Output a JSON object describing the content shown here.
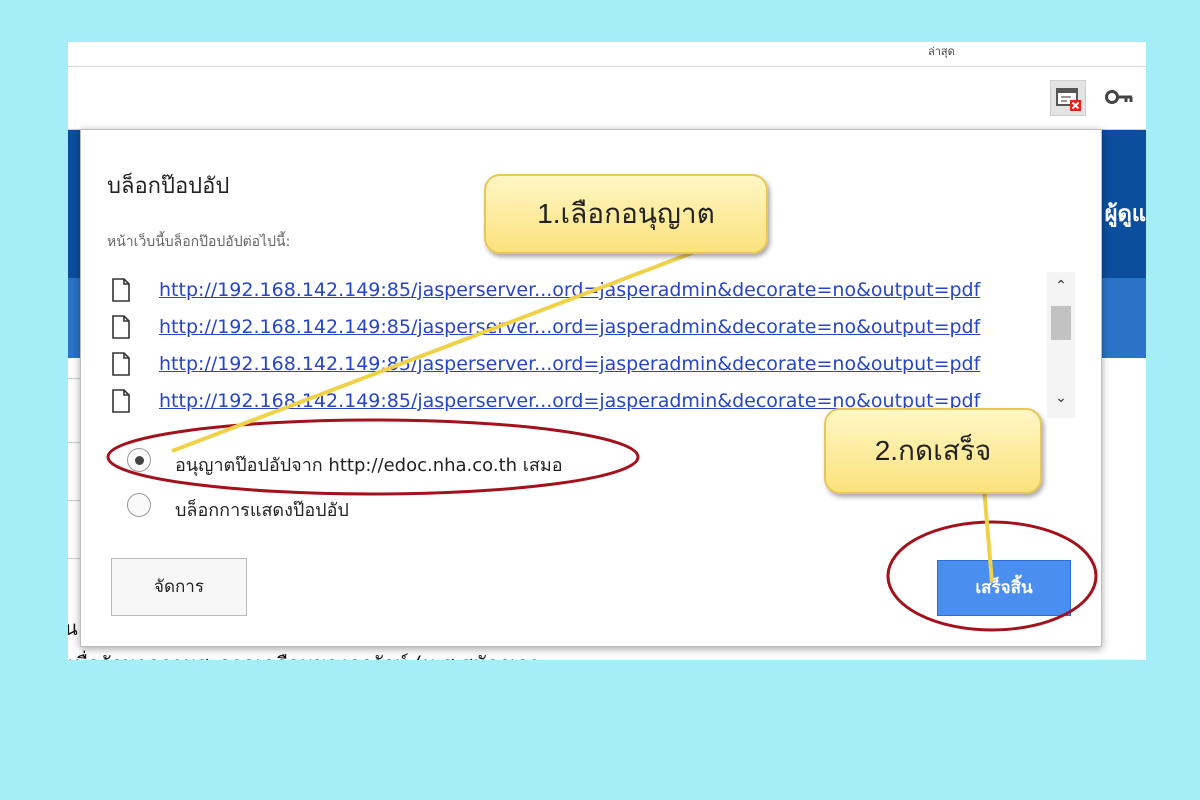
{
  "colors": {
    "background": "#a6eef7",
    "link": "#2645c8",
    "primary_button": "#4a8ef0",
    "highlight_ellipse": "#a3121c",
    "callout_fill": "#fbe27c",
    "callout_line": "#f0d24a",
    "page_header_blue": "#0b4e9e"
  },
  "browser": {
    "tab_scrap": "ล่าสุด",
    "popup_blocked_icon": "popup-blocked-icon",
    "key_icon": "key-icon"
  },
  "page_behind": {
    "header_text": "ผู้ดูแ",
    "line1": "น",
    "line2": "เพื่อรักษาความสะอาดเคลือบของครูรักษ์ (ม.ส.สมัครเอา"
  },
  "dialog": {
    "title": "บล็อกป๊อปอัป",
    "subtitle": "หน้าเว็บนี้บล็อกป๊อปอัปต่อไปนี้:",
    "urls": [
      "http://192.168.142.149:85/jasperserver...ord=jasperadmin&decorate=no&output=pdf",
      "http://192.168.142.149:85/jasperserver...ord=jasperadmin&decorate=no&output=pdf",
      "http://192.168.142.149:85/jasperserver...ord=jasperadmin&decorate=no&output=pdf",
      "http://192.168.142.149:85/jasperserver...ord=jasperadmin&decorate=no&output=pdf"
    ],
    "options": [
      {
        "label": "อนุญาตป๊อปอัปจาก http://edoc.nha.co.th เสมอ",
        "selected": true
      },
      {
        "label": "บล็อกการแสดงป๊อปอัป",
        "selected": false
      }
    ],
    "manage_label": "จัดการ",
    "done_label": "เสร็จสิ้น",
    "scroll": {
      "up": "⌃",
      "down": "⌄"
    }
  },
  "annotations": {
    "callout1": "1.เลือกอนุญาต",
    "callout2": "2.กดเสร็จ"
  }
}
